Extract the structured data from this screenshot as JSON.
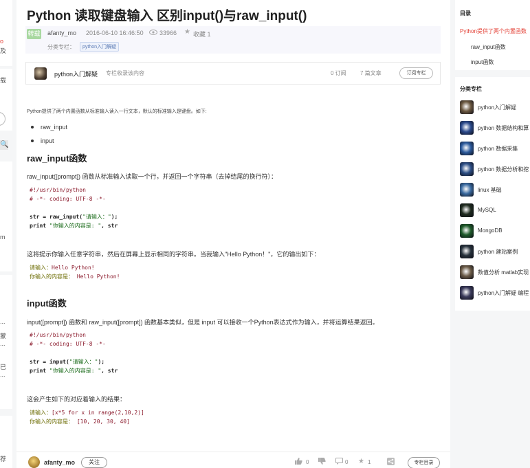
{
  "left_rail": {
    "chars": [
      {
        "text": "o",
        "red": true
      },
      {
        "text": "及",
        "red": false
      },
      {
        "text": "载",
        "red": false
      },
      {
        "text": "m",
        "red": false
      },
      {
        "text": "...",
        "red": false
      },
      {
        "text": "蒙",
        "red": false
      },
      {
        "text": "...",
        "red": false
      },
      {
        "text": "已",
        "red": false
      },
      {
        "text": "...",
        "red": false
      },
      {
        "text": "荐",
        "red": false
      }
    ],
    "search_glyph": "🔍"
  },
  "article": {
    "title": "Python 读取键盘输入 区别input()与raw_input()",
    "repost_tag": "转载",
    "author": "afanty_mo",
    "date": "2016-06-10 16:46:50",
    "views": "33966",
    "favorites": "收藏 1",
    "category_label": "分类专栏：",
    "category_tag": "python入门解疑",
    "column": {
      "name": "python入门解疑",
      "desc": "专栏收录该内容",
      "subs": "0 订阅",
      "articles": "7 篇文章",
      "subscribe": "订阅专栏"
    },
    "intro": "Python提供了两个内置函数从标准输入读入一行文本，默认的标准输入是键盘。如下:",
    "bullets": [
      "raw_input",
      "input"
    ],
    "h_raw": "raw_input函数",
    "p_raw": "raw_input([prompt]) 函数从标准输入读取一个行，并返回一个字符串（去掉结尾的换行符）：",
    "code1": {
      "l1": "#!/usr/bin/python",
      "l2": "# -*- coding: UTF-8 -*-",
      "l3a": "str = raw_input(",
      "l3b": "\"请输入：\"",
      "l3c": ");",
      "l4a": "print ",
      "l4b": "\"你输入的内容是: \"",
      "l4c": ", str"
    },
    "p_raw2": "这将提示你输入任意字符串，然后在屏幕上显示相同的字符串。当我输入\"Hello Python！\"，它的输出如下：",
    "out1": {
      "l1a": "请输入：",
      "l1b": "Hello Python!",
      "l2a": "你输入的内容是： ",
      "l2b": "Hello Python!"
    },
    "h_input": "input函数",
    "p_input": "input([prompt]) 函数和 raw_input([prompt]) 函数基本类似，但是 input 可以接收一个Python表达式作为输入，并将运算结果返回。",
    "code2": {
      "l1": "#!/usr/bin/python",
      "l2": "# -*- coding: UTF-8 -*-",
      "l3a": "str = input(",
      "l3b": "\"请输入：\"",
      "l3c": ");",
      "l4a": "print ",
      "l4b": "\"你输入的内容是: \"",
      "l4c": ", str"
    },
    "p_input2": "这会产生如下的对应着输入的结果：",
    "out2": {
      "l1a": "请输入：",
      "l1b": "[x*5 for x in range(2,10,2)]",
      "l2a": "你输入的内容是： ",
      "l2b": "[10, 20, 30, 40]"
    }
  },
  "bottom_bar": {
    "author": "afanty_mo",
    "follow": "关注",
    "likes": "0",
    "dislikes": "",
    "comments": "0",
    "stars": "1",
    "directory": "专栏目录"
  },
  "toc": {
    "title": "目录",
    "items": [
      "Python提供了两个内置函数",
      "raw_input函数",
      "input函数"
    ]
  },
  "categories": {
    "title": "分类专栏",
    "items": [
      {
        "label": "python入门解疑",
        "color": "#6b5840"
      },
      {
        "label": "python 数据结构和算",
        "color": "#2b4a8c"
      },
      {
        "label": "python 数据采集",
        "color": "#2b5a9c"
      },
      {
        "label": "python 数据分析和挖",
        "color": "#2d4f86"
      },
      {
        "label": "linux 基础",
        "color": "#3a6aa0"
      },
      {
        "label": "MySQL",
        "color": "#1e2a1e"
      },
      {
        "label": "MongoDB",
        "color": "#1e5a2a"
      },
      {
        "label": "python 建站案例",
        "color": "#27323c"
      },
      {
        "label": "数值分析 matlab实现",
        "color": "#6a5a46"
      },
      {
        "label": "python入门解疑 编程",
        "color": "#3a3a5a"
      }
    ]
  }
}
